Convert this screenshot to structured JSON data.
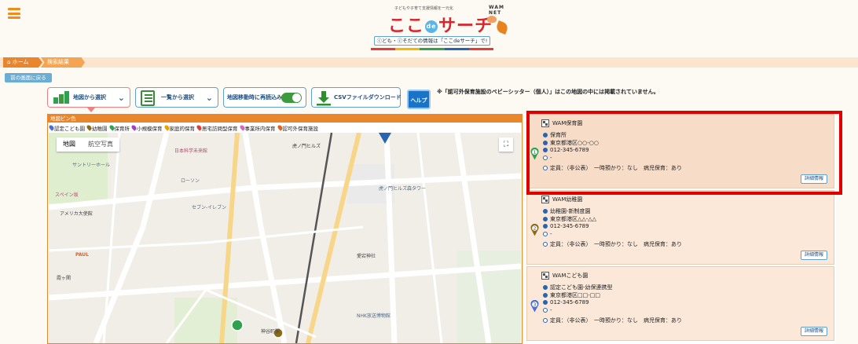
{
  "header": {
    "tagline": "子どもや子育て支援情報を一元化",
    "wam": "WAM NET",
    "logo_a": "ここ",
    "logo_de": "de",
    "logo_b": "サーチ",
    "subtitle": "ⓒども・ⓒそだての情報は「ここdeサーチ」で!"
  },
  "breadcrumb": {
    "home": "ホーム",
    "current": "検索結果"
  },
  "back_label": "前の画面に戻る",
  "toolbar": {
    "map_select": "地図から選択",
    "list_select": "一覧から選択",
    "reload_on_move": "地図移動時に再読込み",
    "csv_download": "CSVファイルダウンロード",
    "help": "ヘルプ"
  },
  "notice": "※「認可外保育施設のベビーシッター（個人）」はこの地図の中には掲載されていません。",
  "map": {
    "header": "地図ピン色",
    "legend": [
      {
        "label": "認定こども園",
        "color": "#4a6fd0"
      },
      {
        "label": "幼稚園",
        "color": "#8b6a1a"
      },
      {
        "label": "保育所",
        "color": "#2fa14f"
      },
      {
        "label": "小規模保育",
        "color": "#a43fc4"
      },
      {
        "label": "家庭的保育",
        "color": "#e8a400"
      },
      {
        "label": "居宅訪問型保育",
        "color": "#e23b3b"
      },
      {
        "label": "事業所内保育",
        "color": "#d06ac0"
      },
      {
        "label": "認可外保育施設",
        "color": "#e06020"
      }
    ],
    "tab_map": "地図",
    "tab_aerial": "航空写真",
    "fullscreen": "⛶",
    "places": [
      "日本科学未来館",
      "サントリーホール",
      "虎ノ門ヒルズ",
      "虎ノ門ヒルズ森タワー",
      "愛宕神社",
      "神谷町駅",
      "スペイン坂",
      "アメリカ大使館",
      "ローソン",
      "セブン-イレブン",
      "NHK放送博物館",
      "PAUL",
      "霞ヶ関"
    ]
  },
  "results": [
    {
      "num": "1",
      "pin": "#2fa14f",
      "title": "WAM保育園",
      "type": "保育所",
      "address": "東京都港区○○-○○",
      "phone": "012-345-6789",
      "extra": "-",
      "info": "定員：（非公表）　一時預かり：なし　病児保育：あり",
      "detail": "詳細情報"
    },
    {
      "num": "2",
      "pin": "#8b6a1a",
      "title": "WAM幼稚園",
      "type": "幼稚園-新制度園",
      "address": "東京都港区△△-△△",
      "phone": "012-345-6789",
      "extra": "-",
      "info": "定員：（非公表）　一時預かり：なし　病児保育：あり",
      "detail": "詳細情報"
    },
    {
      "num": "3",
      "pin": "#4a6fd0",
      "title": "WAMこども園",
      "type": "認定こども園-幼保連携型",
      "address": "東京都港区□□-□□",
      "phone": "012-345-6789",
      "extra": "-",
      "info": "定員：（非公表）　一時預かり：なし　病児保育：あり",
      "detail": "詳細情報"
    }
  ]
}
